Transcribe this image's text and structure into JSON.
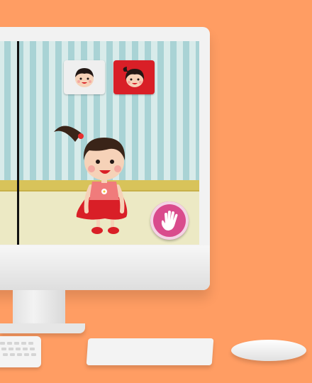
{
  "scene": {
    "background_color": "#FF9D63"
  },
  "game_ui": {
    "character_select": [
      {
        "name": "boy",
        "icon": "boy-face-icon",
        "selected": false
      },
      {
        "name": "girl",
        "icon": "girl-face-icon",
        "selected": true
      }
    ],
    "wave_button": {
      "icon": "hand-icon",
      "color": "#D94B8D"
    }
  },
  "hardware": {
    "computer": "imac",
    "logo_icon": "apple-logo-icon",
    "accessories": [
      "keyboard",
      "trackpad",
      "mouse"
    ]
  }
}
